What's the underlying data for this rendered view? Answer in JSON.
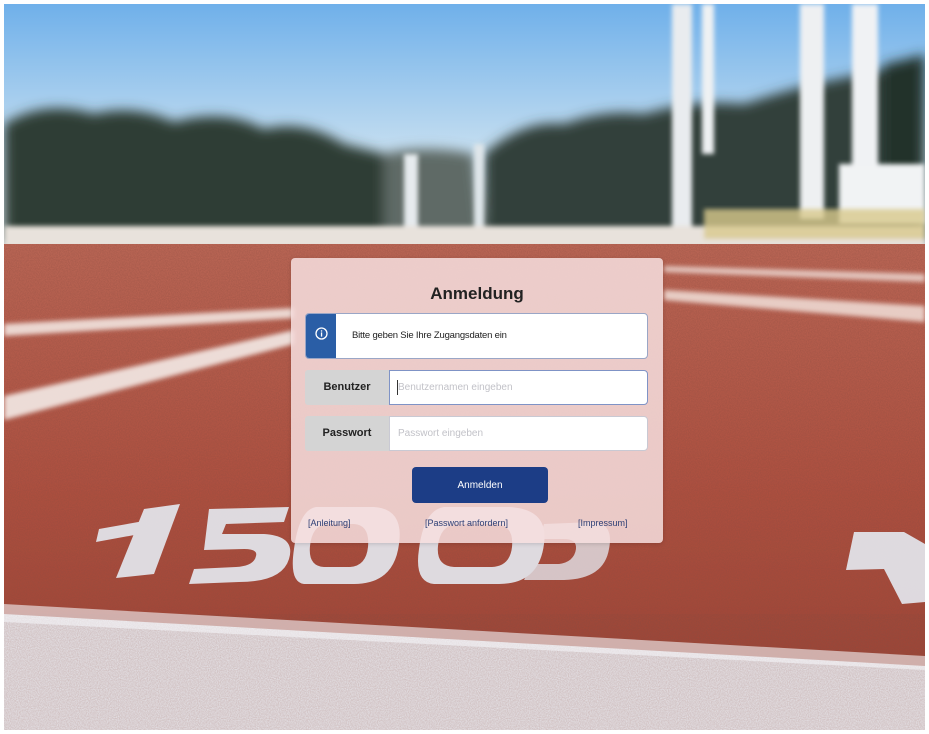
{
  "login": {
    "title": "Anmeldung",
    "info_message": "Bitte geben Sie Ihre Zugangsdaten ein",
    "username_label": "Benutzer",
    "username_placeholder": "Benutzernamen eingeben",
    "username_value": "",
    "password_label": "Passwort",
    "password_placeholder": "Passwort eingeben",
    "password_value": "",
    "submit_label": "Anmelden"
  },
  "footer": {
    "links": [
      {
        "label": "[Anleitung]"
      },
      {
        "label": "[Passwort anfordern]"
      },
      {
        "label": "[Impressum]"
      }
    ]
  },
  "colors": {
    "accent": "#1c3d86",
    "info_icon_bg": "#2a5ea6",
    "card_bg": "#f6dede",
    "track": "#b4503f"
  },
  "icons": {
    "info": "info-circle-icon"
  }
}
